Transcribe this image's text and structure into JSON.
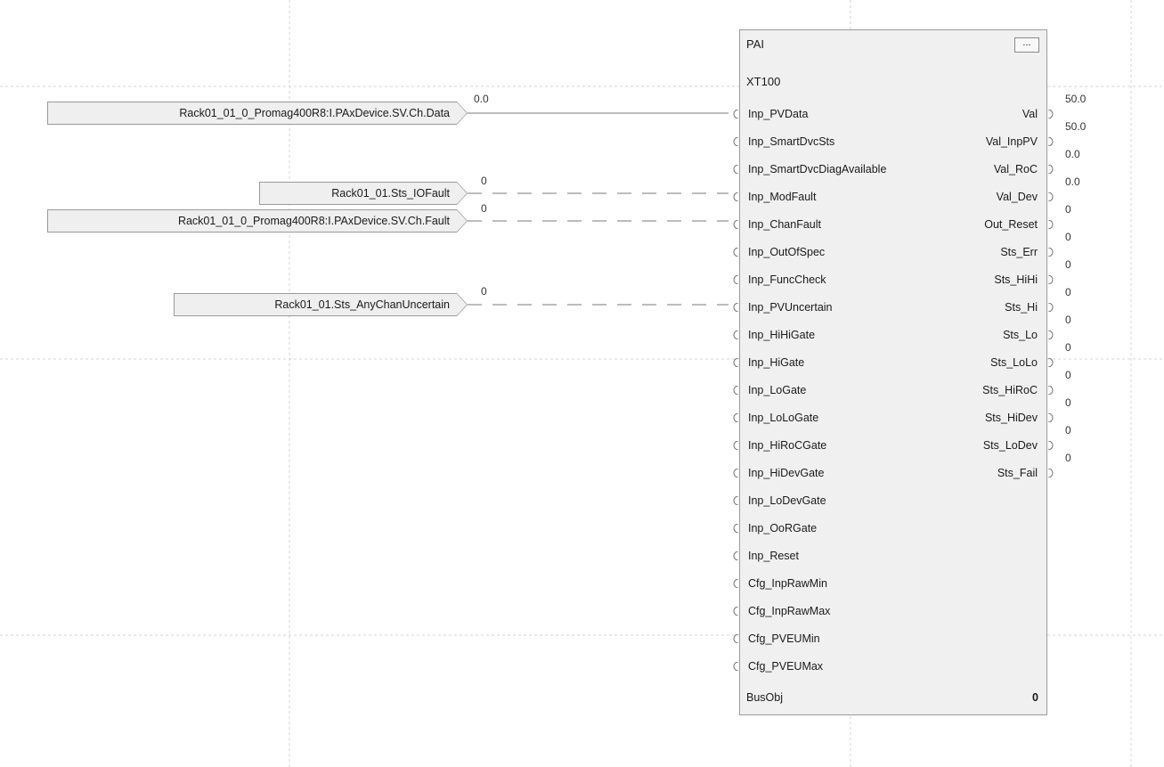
{
  "block": {
    "type": "PAI",
    "name": "XT100",
    "menu_button": "...",
    "inputs": [
      "Inp_PVData",
      "Inp_SmartDvcSts",
      "Inp_SmartDvcDiagAvailable",
      "Inp_ModFault",
      "Inp_ChanFault",
      "Inp_OutOfSpec",
      "Inp_FuncCheck",
      "Inp_PVUncertain",
      "Inp_HiHiGate",
      "Inp_HiGate",
      "Inp_LoGate",
      "Inp_LoLoGate",
      "Inp_HiRoCGate",
      "Inp_HiDevGate",
      "Inp_LoDevGate",
      "Inp_OoRGate",
      "Inp_Reset",
      "Cfg_InpRawMin",
      "Cfg_InpRawMax",
      "Cfg_PVEUMin",
      "Cfg_PVEUMax"
    ],
    "outputs": [
      "Val",
      "Val_InpPV",
      "Val_RoC",
      "Val_Dev",
      "Out_Reset",
      "Sts_Err",
      "Sts_HiHi",
      "Sts_Hi",
      "Sts_Lo",
      "Sts_LoLo",
      "Sts_HiRoC",
      "Sts_HiDev",
      "Sts_LoDev",
      "Sts_Fail"
    ],
    "output_values": [
      "50.0",
      "50.0",
      "0.0",
      "0.0",
      "0",
      "0",
      "0",
      "0",
      "0",
      "0",
      "0",
      "0",
      "0",
      "0"
    ],
    "bus_label": "BusObj",
    "bus_value": "0"
  },
  "input_tags": [
    {
      "label": "Rack01_01_0_Promag400R8:I.PAxDevice.SV.Ch.Data",
      "value": "0.0"
    },
    {
      "label": "Rack01_01.Sts_IOFault",
      "value": "0"
    },
    {
      "label": "Rack01_01_0_Promag400R8:I.PAxDevice.SV.Ch.Fault",
      "value": "0"
    },
    {
      "label": "Rack01_01.Sts_AnyChanUncertain",
      "value": "0"
    }
  ]
}
